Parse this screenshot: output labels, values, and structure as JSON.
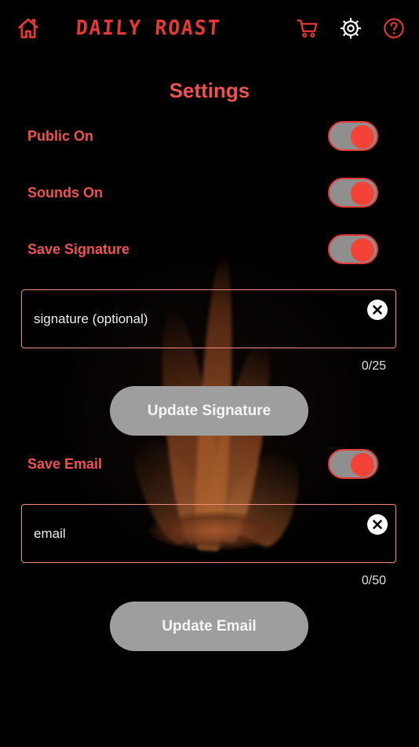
{
  "app": {
    "logo_text": "DAILY ROAST"
  },
  "header": {
    "icons": {
      "home": "home-icon",
      "cart": "cart-icon",
      "settings": "gear-icon",
      "help": "help-icon"
    }
  },
  "page": {
    "title": "Settings"
  },
  "settings": {
    "public": {
      "label": "Public On",
      "enabled": true
    },
    "sounds": {
      "label": "Sounds On",
      "enabled": true
    },
    "save_signature": {
      "label": "Save Signature",
      "enabled": true
    },
    "signature_field": {
      "placeholder": "signature (optional)",
      "counter": "0/25",
      "max": 25
    },
    "update_signature": {
      "label": "Update Signature"
    },
    "save_email": {
      "label": "Save Email",
      "enabled": true
    },
    "email_field": {
      "placeholder": "email",
      "counter": "0/50",
      "max": 50
    },
    "update_email": {
      "label": "Update Email"
    }
  },
  "colors": {
    "accent": "#e53935",
    "button_gray": "#9e9e9e",
    "background": "#000000"
  }
}
